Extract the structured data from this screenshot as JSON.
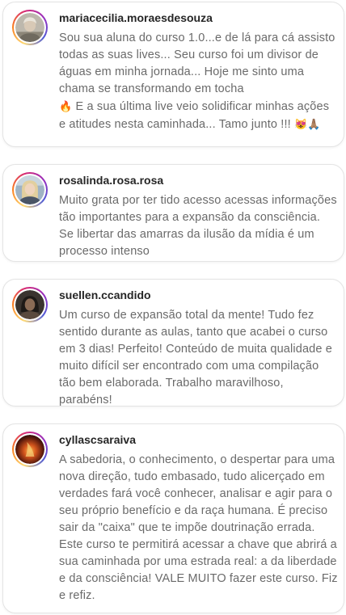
{
  "comments": [
    {
      "username": "mariacecilia.moraesdesouza",
      "text": "Sou sua aluna do curso 1.0...e de lá para cá assisto todas as suas lives... Seu curso foi um divisor de águas em minha jornada... Hoje me sinto uma chama se transformando em tocha",
      "emoji_fire": "🔥",
      "text_after_emoji": " E a sua última live veio solidificar minhas ações e atitudes nesta caminhada... Tamo junto !!! ",
      "emoji_end": "😻🙏🏽",
      "avatar_icon": "woman-portrait-avatar"
    },
    {
      "username": "rosalinda.rosa.rosa",
      "text": "Muito grata por ter tido acesso acessas informações tão importantes para a expansão da consciência. Se libertar das amarras da ilusão da mídia é um processo intenso",
      "avatar_icon": "woman-blonde-avatar"
    },
    {
      "username": "suellen.ccandido",
      "text": "Um curso de expansão total da mente! Tudo fez sentido durante as aulas, tanto que acabei o curso em 3 dias! Perfeito! Conteúdo de muita qualidade e muito difícil ser encontrado com uma compilação tão bem elaborada. Trabalho maravilhoso, parabéns!",
      "avatar_icon": "woman-dark-portrait-avatar"
    },
    {
      "username": "cyllascsaraiva",
      "text": "A sabedoria, o conhecimento, o despertar para uma nova direção, tudo embasado, tudo alicerçado em verdades fará você conhecer, analisar e agir para o seu próprio benefício e da raça humana. É preciso sair da \"caixa\" que te impõe doutrinação errada. Este curso te permitirá acessar a chave que abrirá a sua caminhada por uma estrada real: a da liberdade e da consciência! VALE MUITO fazer este curso. Fiz e refiz.",
      "avatar_icon": "fire-glow-avatar"
    }
  ],
  "colors": {
    "username": "#262626",
    "comment_text": "#6a6a6a",
    "card_border": "#e4e4e4"
  }
}
